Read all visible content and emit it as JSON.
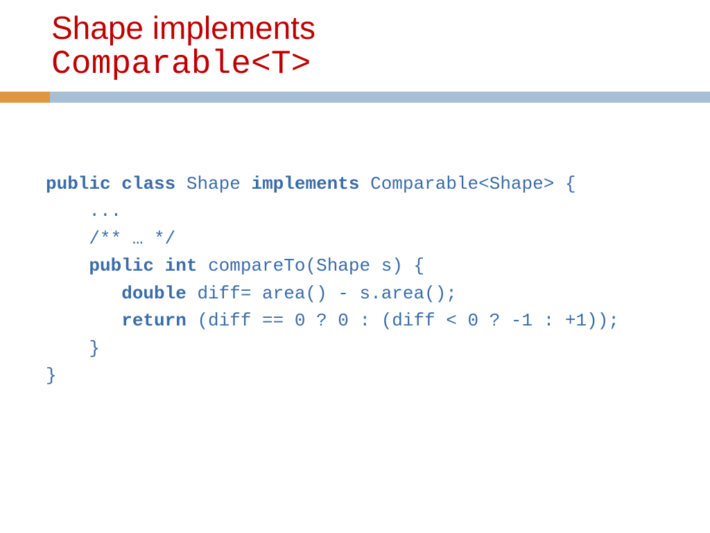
{
  "title": {
    "line1": "Shape implements",
    "line2": "Comparable<T>"
  },
  "code": {
    "kw_public1": "public",
    "kw_class": "class",
    "t_shape": " Shape ",
    "kw_implements": "implements",
    "t_sig": " Comparable<Shape> {",
    "t_dots": "    ...",
    "t_comment": "    /** … */",
    "line_method_pre": "    ",
    "kw_public2": "public",
    "kw_int": "int",
    "t_method": " compareTo(Shape s) {",
    "line_diff_pre": "       ",
    "kw_double": "double",
    "t_diff": " diff= area() - s.area();",
    "line_ret_pre": "       ",
    "kw_return": "return",
    "t_ret": " (diff == 0 ? 0 : (diff < 0 ? -1 : +1));",
    "t_close1": "    }",
    "t_close2": "}"
  }
}
